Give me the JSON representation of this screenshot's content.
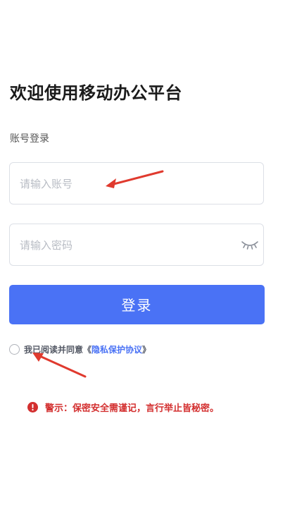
{
  "page": {
    "title": "欢迎使用移动办公平台",
    "subtitle": "账号登录"
  },
  "form": {
    "account_placeholder": "请输入账号",
    "password_placeholder": "请输入密码",
    "password_toggle_icon": "eye-closed-icon",
    "login_label": "登录"
  },
  "agreement": {
    "prefix": "我已阅读并同意",
    "quote_open": "《",
    "link_label": "隐私保护协议",
    "quote_close": "》",
    "checked": false
  },
  "warning": {
    "icon": "exclamation-circle-icon",
    "text": "警示：保密安全需谨记，言行举止皆秘密。"
  },
  "colors": {
    "primary": "#4a72f5",
    "warning": "#d32f2f",
    "annotation_arrow": "#e03a2e"
  }
}
